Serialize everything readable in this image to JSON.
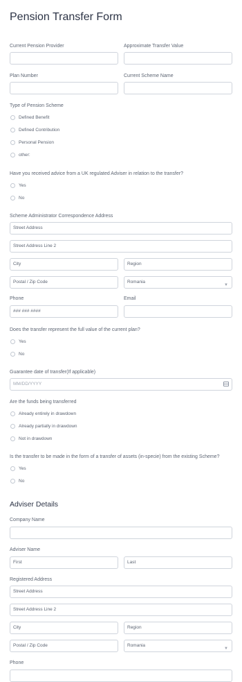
{
  "form_title": "Pension Transfer Form",
  "provider": {
    "label": "Current Pension Provider",
    "value": ""
  },
  "transfer_value": {
    "label": "Approximate Transfer Value",
    "value": ""
  },
  "plan_number": {
    "label": "Plan Number",
    "value": ""
  },
  "scheme_name": {
    "label": "Current Scheme Name",
    "value": ""
  },
  "scheme_type": {
    "label": "Type of Pension Scheme",
    "options": [
      "Defined Benefit",
      "Defined Contribution",
      "Personal Pension",
      "other:"
    ]
  },
  "advice": {
    "label": "Have you received advice from a UK regulated Adviser in relation to the transfer?",
    "options": [
      "Yes",
      "No"
    ]
  },
  "admin_address": {
    "label": "Scheme Administrator Correspondence Address",
    "street": "Street Address",
    "street2": "Street Address Line 2",
    "city": "City",
    "region": "Region",
    "postal": "Postal / Zip Code",
    "country": "Romania"
  },
  "phone": {
    "label": "Phone",
    "placeholder": "### ### ####"
  },
  "email": {
    "label": "Email",
    "value": ""
  },
  "full_value": {
    "label": "Does the transfer represent the full value of the current plan?",
    "options": [
      "Yes",
      "No"
    ]
  },
  "guarantee_date": {
    "label": "Guarantee date of transfer(If applicable)",
    "placeholder": "MM/DD/YYYY"
  },
  "funds": {
    "label": "Are the funds being transferred",
    "options": [
      "Already entirely in drawdown",
      "Already partially in drawdown",
      "Not in drawdown"
    ]
  },
  "in_specie": {
    "label": "Is the transfer to be made in the form of a transfer of assets (in-specie) from the existing Scheme?",
    "options": [
      "Yes",
      "No"
    ]
  },
  "adviser_section": "Adviser Details",
  "company": {
    "label": "Company Name",
    "value": ""
  },
  "adviser_name": {
    "label": "Adviser Name",
    "first": "First",
    "last": "Last"
  },
  "registered_address": {
    "label": "Registered Address",
    "street": "Street Address",
    "street2": "Street Address Line 2",
    "city": "City",
    "region": "Region",
    "postal": "Postal / Zip Code",
    "country": "Romania"
  },
  "adviser_phone": {
    "label": "Phone"
  }
}
